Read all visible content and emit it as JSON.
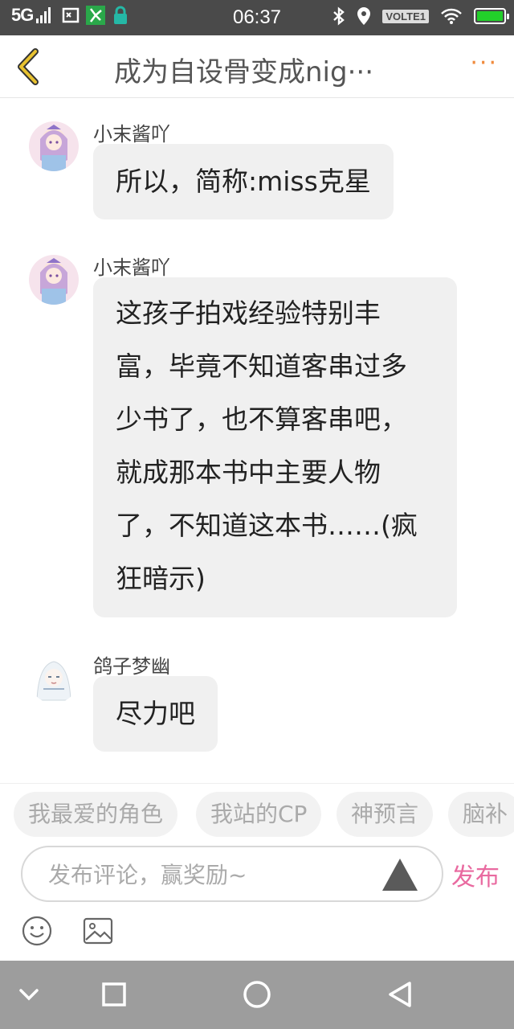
{
  "status_bar": {
    "network": "5G",
    "time": "06:37",
    "volte": "VOLTE1"
  },
  "header": {
    "title": "成为自设骨变成nig···",
    "more": "···",
    "icons": {
      "back": "chevron-left-icon",
      "more": "more-dots-icon"
    },
    "accent_color": "#f08a3c"
  },
  "messages": [
    {
      "author": "小末酱吖",
      "text": "所以，简称:miss克星",
      "avatar": "anime-avatar-pink"
    },
    {
      "author": "小末酱吖",
      "lines": [
        "这孩子拍戏经验特别丰",
        "富，毕竟不知道客串过多",
        "少书了，也不算客串吧，",
        "就成那本书中主要人物",
        "了，不知道这本书……(疯",
        "狂暗示)"
      ],
      "avatar": "anime-avatar-pink"
    },
    {
      "author": "鸽子梦幽",
      "text": "尽力吧",
      "avatar": "anime-avatar-white"
    }
  ],
  "tags": [
    "我最爱的角色",
    "我站的CP",
    "神预言",
    "脑补"
  ],
  "composer": {
    "placeholder": "发布评论，赢奖励~",
    "send_label": "发布",
    "send_color": "#e96aa0",
    "icons": [
      "triangle-icon",
      "emoji-icon",
      "image-icon"
    ]
  },
  "nav_bar": {
    "icons": [
      "chevron-down-icon",
      "square-icon",
      "circle-icon",
      "triangle-back-icon"
    ]
  }
}
